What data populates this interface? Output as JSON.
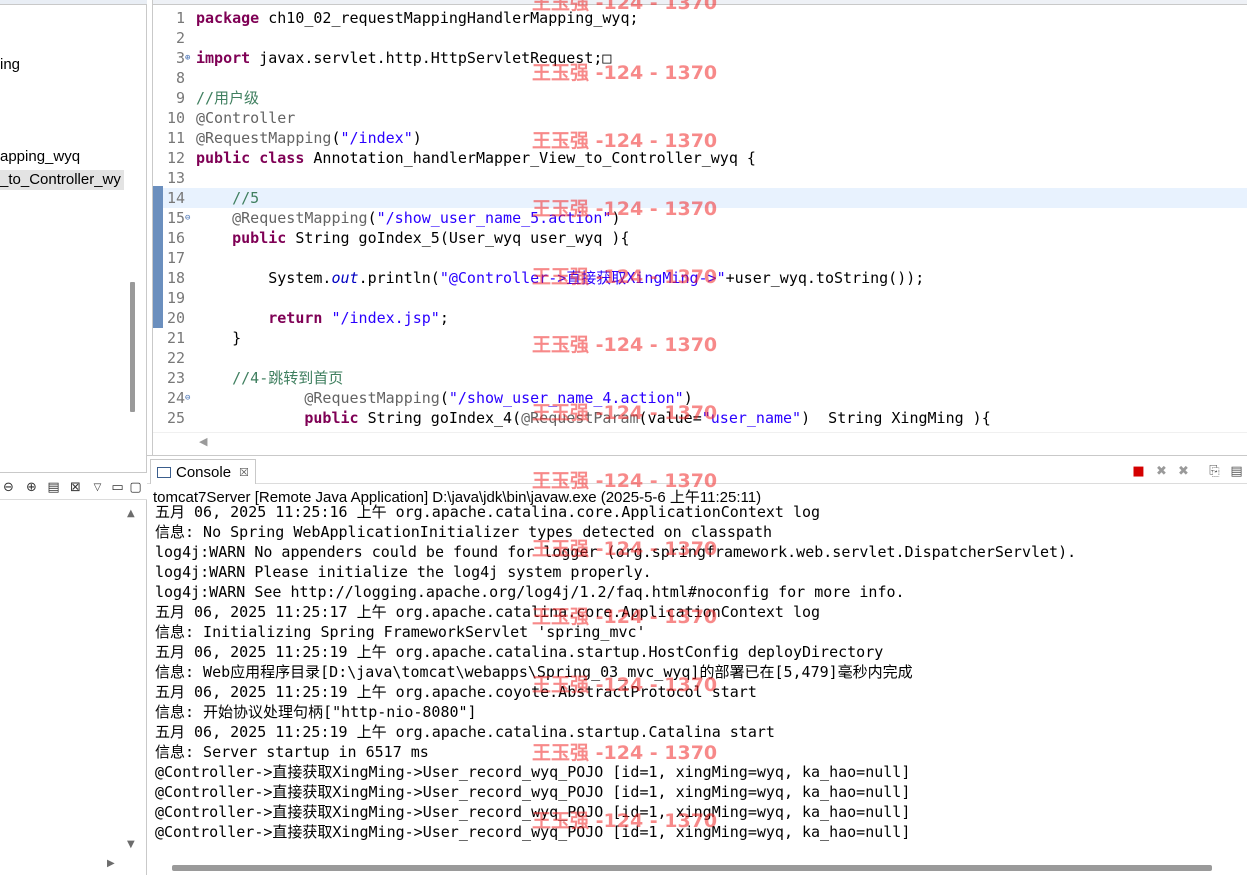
{
  "explorer": {
    "items": [
      {
        "label": "ing",
        "selected": false
      },
      {
        "label": "apping_wyq",
        "selected": false
      },
      {
        "label": "_to_Controller_wy",
        "selected": true
      }
    ]
  },
  "left_toolbar": {
    "icons": [
      "zoom-out-icon",
      "zoom-in-icon",
      "fit-icon",
      "fullscreen-icon",
      "view-menu-icon",
      "minimize-icon",
      "maximize-icon"
    ]
  },
  "editor": {
    "lines": [
      {
        "n": "1",
        "html": "<span class=\"kw\">package</span> ch10_02_requestMappingHandlerMapping_wyq;"
      },
      {
        "n": "2",
        "html": ""
      },
      {
        "n": "3",
        "fold": "⊕",
        "html": "<span class=\"kw\">import</span> javax.servlet.http.HttpServletRequest;□"
      },
      {
        "n": "8",
        "html": ""
      },
      {
        "n": "9",
        "html": "<span class=\"cmt\">//用户级</span>"
      },
      {
        "n": "10",
        "html": "<span class=\"ann\">@Controller</span>"
      },
      {
        "n": "11",
        "html": "<span class=\"ann\">@RequestMapping</span>(<span class=\"str\">\"/index\"</span>)"
      },
      {
        "n": "12",
        "html": "<span class=\"kw\">public</span> <span class=\"kw\">class</span> Annotation_handlerMapper_View_to_Controller_wyq {"
      },
      {
        "n": "13",
        "html": ""
      },
      {
        "n": "14",
        "current": true,
        "html": "    <span class=\"cmt\">//5</span>"
      },
      {
        "n": "15",
        "fold": "⊖",
        "html": "    <span class=\"ann\">@RequestMapping</span>(<span class=\"str\">\"/show_user_name_5.action\"</span>)"
      },
      {
        "n": "16",
        "html": "    <span class=\"kw\">public</span> String goIndex_5(User_wyq user_wyq ){"
      },
      {
        "n": "17",
        "html": ""
      },
      {
        "n": "18",
        "html": "        System.<span class=\"fld\">out</span>.println(<span class=\"str\">\"@Controller->直接获取XingMing->\"</span>+user_wyq.toString());"
      },
      {
        "n": "19",
        "html": ""
      },
      {
        "n": "20",
        "html": "        <span class=\"kw\">return</span> <span class=\"str\">\"/index.jsp\"</span>;"
      },
      {
        "n": "21",
        "html": "    }"
      },
      {
        "n": "22",
        "html": ""
      },
      {
        "n": "23",
        "html": "    <span class=\"cmt\">//4-跳转到首页</span>"
      },
      {
        "n": "24",
        "fold": "⊖",
        "html": "            <span class=\"ann\">@RequestMapping</span>(<span class=\"str\">\"/show_user_name_4.action\"</span>)"
      },
      {
        "n": "25",
        "html": "            <span class=\"kw\">public</span> String goIndex_4(<span class=\"ann\">@RequestParam</span>(value=<span class=\"str\">\"user_name\"</span>)  String XingMing ){"
      }
    ]
  },
  "console": {
    "tab_label": "Console",
    "tab_close": "☒",
    "subtitle": "tomcat7Server [Remote Java Application] D:\\java\\jdk\\bin\\javaw.exe (2025-5-6 上午11:25:11)",
    "lines": [
      "五月 06, 2025 11:25:16 上午 org.apache.catalina.core.ApplicationContext log",
      "信息: No Spring WebApplicationInitializer types detected on classpath",
      "log4j:WARN No appenders could be found for logger (org.springframework.web.servlet.DispatcherServlet).",
      "log4j:WARN Please initialize the log4j system properly.",
      "log4j:WARN See http://logging.apache.org/log4j/1.2/faq.html#noconfig for more info.",
      "五月 06, 2025 11:25:17 上午 org.apache.catalina.core.ApplicationContext log",
      "信息: Initializing Spring FrameworkServlet 'spring_mvc'",
      "五月 06, 2025 11:25:19 上午 org.apache.catalina.startup.HostConfig deployDirectory",
      "信息: Web应用程序目录[D:\\java\\tomcat\\webapps\\Spring_03_mvc_wyq]的部署已在[5,479]毫秒内完成",
      "五月 06, 2025 11:25:19 上午 org.apache.coyote.AbstractProtocol start",
      "信息: 开始协议处理句柄[\"http-nio-8080\"]",
      "五月 06, 2025 11:25:19 上午 org.apache.catalina.startup.Catalina start",
      "信息: Server startup in 6517 ms",
      "@Controller->直接获取XingMing->User_record_wyq_POJO [id=1, xingMing=wyq, ka_hao=null]",
      "@Controller->直接获取XingMing->User_record_wyq_POJO [id=1, xingMing=wyq, ka_hao=null]",
      "@Controller->直接获取XingMing->User_record_wyq_POJO [id=1, xingMing=wyq, ka_hao=null]",
      "@Controller->直接获取XingMing->User_record_wyq_POJO [id=1, xingMing=wyq, ka_hao=null]"
    ],
    "toolbar_icons": [
      "terminate-icon",
      "remove-launch-icon",
      "remove-all-icon",
      "pin-console-icon",
      "display-console-icon"
    ]
  },
  "watermark": {
    "text": "王玉强 -124 - 1370",
    "count": 13
  },
  "colors": {
    "keyword": "#7f0055",
    "string": "#2a00ff",
    "comment": "#3f7f5f",
    "annotation": "#646464",
    "watermark": "#f02828"
  }
}
